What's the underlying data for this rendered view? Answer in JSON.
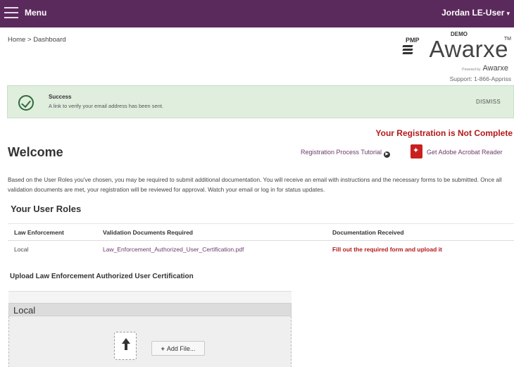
{
  "topbar": {
    "menu_label": "Menu",
    "user_name": "Jordan LE-User",
    "user_caret": "▾",
    "bg_color": "#5b2a5c"
  },
  "breadcrumb": {
    "home": "Home",
    "separator": ">",
    "current": "Dashboard"
  },
  "logo": {
    "pmp": "PMP",
    "demo": "DEMO",
    "brand": "Awarxe",
    "tm": "TM",
    "powered_by": "Powered by",
    "powered_brand": "Awarxe",
    "support": "Support: 1-866-Appriss"
  },
  "alert": {
    "title": "Success",
    "message": "A link to verify your email address has been sent.",
    "dismiss": "DISMISS",
    "icon": "check-circle-icon"
  },
  "registration_status": "Your Registration is Not Complete",
  "welcome": {
    "heading": "Welcome",
    "tutorial_link": "Registration Process Tutorial",
    "acrobat_link": "Get Adobe Acrobat Reader"
  },
  "intro_text": "Based on the User Roles you've chosen, you may be required to submit additional documentation. You will receive an email with instructions and the necessary forms to be submitted. Once all validation documents are met, your registration will be reviewed for approval. Watch your email or log in for status updates.",
  "roles": {
    "heading": "Your User Roles",
    "columns": [
      "Law Enforcement",
      "Validation Documents Required",
      "Documentation Received"
    ],
    "rows": [
      {
        "role": "Local",
        "document": "Law_Enforcement_Authorized_User_Certification.pdf",
        "received": "Fill out the required form and upload it"
      }
    ]
  },
  "upload": {
    "heading": "Upload Law Enforcement Authorized User Certification",
    "panel_title": "Local",
    "add_file_label": "Add File..."
  },
  "colors": {
    "accent_purple": "#5b2a5c",
    "link_purple": "#6b3b6b",
    "error_red": "#b51818",
    "success_green_bg": "#dfeedd"
  }
}
